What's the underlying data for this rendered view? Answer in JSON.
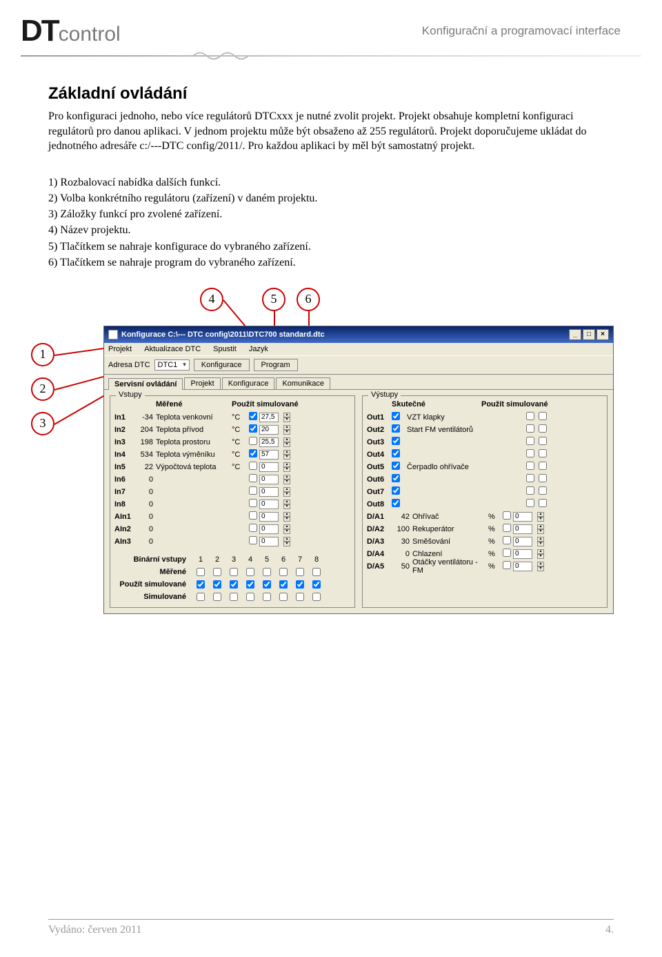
{
  "header": {
    "logo_dt": "DT",
    "logo_control": "control",
    "subtitle": "Konfigurační a programovací interface"
  },
  "heading": "Základní ovládání",
  "para": "Pro konfiguraci jednoho, nebo více regulátorů DTCxxx je nutné zvolit projekt. Projekt obsahuje kompletní konfiguraci regulátorů pro danou aplikaci. V jednom projektu může být obsaženo až 255 regulátorů. Projekt doporučujeme ukládat do jednotného adresáře c:/---DTC config/2011/. Pro každou aplikaci by měl být samostatný projekt.",
  "list": [
    "1)  Rozbalovací nabídka dalších funkcí.",
    "2)  Volba konkrétního regulátoru (zařízení) v daném projektu.",
    "3)  Záložky funkcí pro zvolené zařízení.",
    "4)  Název projektu.",
    "5)  Tlačítkem se nahraje konfigurace do vybraného zařízení.",
    "6)  Tlačítkem se nahraje program do vybraného zařízení."
  ],
  "callouts": {
    "c1": "1",
    "c2": "2",
    "c3": "3",
    "c4": "4",
    "c5": "5",
    "c6": "6"
  },
  "win": {
    "title": "Konfigurace C:\\--- DTC config\\2011\\DTC700 standard.dtc",
    "menu": [
      "Projekt",
      "Aktualizace DTC",
      "Spustit",
      "Jazyk"
    ],
    "toolbar": {
      "addr_label": "Adresa DTC",
      "addr_value": "DTC1",
      "btn_config": "Konfigurace",
      "btn_program": "Program"
    },
    "tabs": [
      "Servisní ovládání",
      "Projekt",
      "Konfigurace",
      "Komunikace"
    ],
    "inputs": {
      "group": "Vstupy",
      "h_measured": "Měřené",
      "h_sim": "Použít simulované",
      "rows": [
        {
          "n": "In1",
          "v": "-34",
          "d": "Teplota venkovní",
          "u": "°C",
          "chk": true,
          "sim": "27,5"
        },
        {
          "n": "In2",
          "v": "204",
          "d": "Teplota přívod",
          "u": "°C",
          "chk": true,
          "sim": "20"
        },
        {
          "n": "In3",
          "v": "198",
          "d": "Teplota prostoru",
          "u": "°C",
          "chk": false,
          "sim": "25,5"
        },
        {
          "n": "In4",
          "v": "534",
          "d": "Teplota výměníku",
          "u": "°C",
          "chk": true,
          "sim": "57"
        },
        {
          "n": "In5",
          "v": "22",
          "d": "Výpočtová teplota",
          "u": "°C",
          "chk": false,
          "sim": "0"
        },
        {
          "n": "In6",
          "v": "0",
          "d": "",
          "u": "",
          "chk": false,
          "sim": "0"
        },
        {
          "n": "In7",
          "v": "0",
          "d": "",
          "u": "",
          "chk": false,
          "sim": "0"
        },
        {
          "n": "In8",
          "v": "0",
          "d": "",
          "u": "",
          "chk": false,
          "sim": "0"
        },
        {
          "n": "AIn1",
          "v": "0",
          "d": "",
          "u": "",
          "chk": false,
          "sim": "0"
        },
        {
          "n": "AIn2",
          "v": "0",
          "d": "",
          "u": "",
          "chk": false,
          "sim": "0"
        },
        {
          "n": "AIn3",
          "v": "0",
          "d": "",
          "u": "",
          "chk": false,
          "sim": "0"
        }
      ],
      "bin_header": "Binární vstupy",
      "bin_nums": [
        "1",
        "2",
        "3",
        "4",
        "5",
        "6",
        "7",
        "8"
      ],
      "bin_measured": "Měřené",
      "bin_use_sim": "Použít simulované",
      "bin_sim": "Simulované"
    },
    "outputs": {
      "group": "Výstupy",
      "h_real": "Skutečné",
      "h_sim": "Použít simulované",
      "rows": [
        {
          "n": "Out1",
          "chk": true,
          "d": "VZT klapky"
        },
        {
          "n": "Out2",
          "chk": true,
          "d": "Start FM ventilátorů"
        },
        {
          "n": "Out3",
          "chk": true,
          "d": ""
        },
        {
          "n": "Out4",
          "chk": true,
          "d": ""
        },
        {
          "n": "Out5",
          "chk": true,
          "d": "Čerpadlo ohřívače"
        },
        {
          "n": "Out6",
          "chk": true,
          "d": ""
        },
        {
          "n": "Out7",
          "chk": true,
          "d": ""
        },
        {
          "n": "Out8",
          "chk": true,
          "d": ""
        }
      ],
      "da_rows": [
        {
          "n": "D/A1",
          "v": "42",
          "d": "Ohřívač",
          "u": "%",
          "chk": false,
          "sim": "0"
        },
        {
          "n": "D/A2",
          "v": "100",
          "d": "Rekuperátor",
          "u": "%",
          "chk": false,
          "sim": "0"
        },
        {
          "n": "D/A3",
          "v": "30",
          "d": "Směšování",
          "u": "%",
          "chk": false,
          "sim": "0"
        },
        {
          "n": "D/A4",
          "v": "0",
          "d": "Chlazení",
          "u": "%",
          "chk": false,
          "sim": "0"
        },
        {
          "n": "D/A5",
          "v": "50",
          "d": "Otáčky ventilátoru - FM",
          "u": "%",
          "chk": false,
          "sim": "0"
        }
      ]
    }
  },
  "footer": {
    "left_label": "Vydáno:",
    "left_value": " červen 2011",
    "page": "4."
  }
}
